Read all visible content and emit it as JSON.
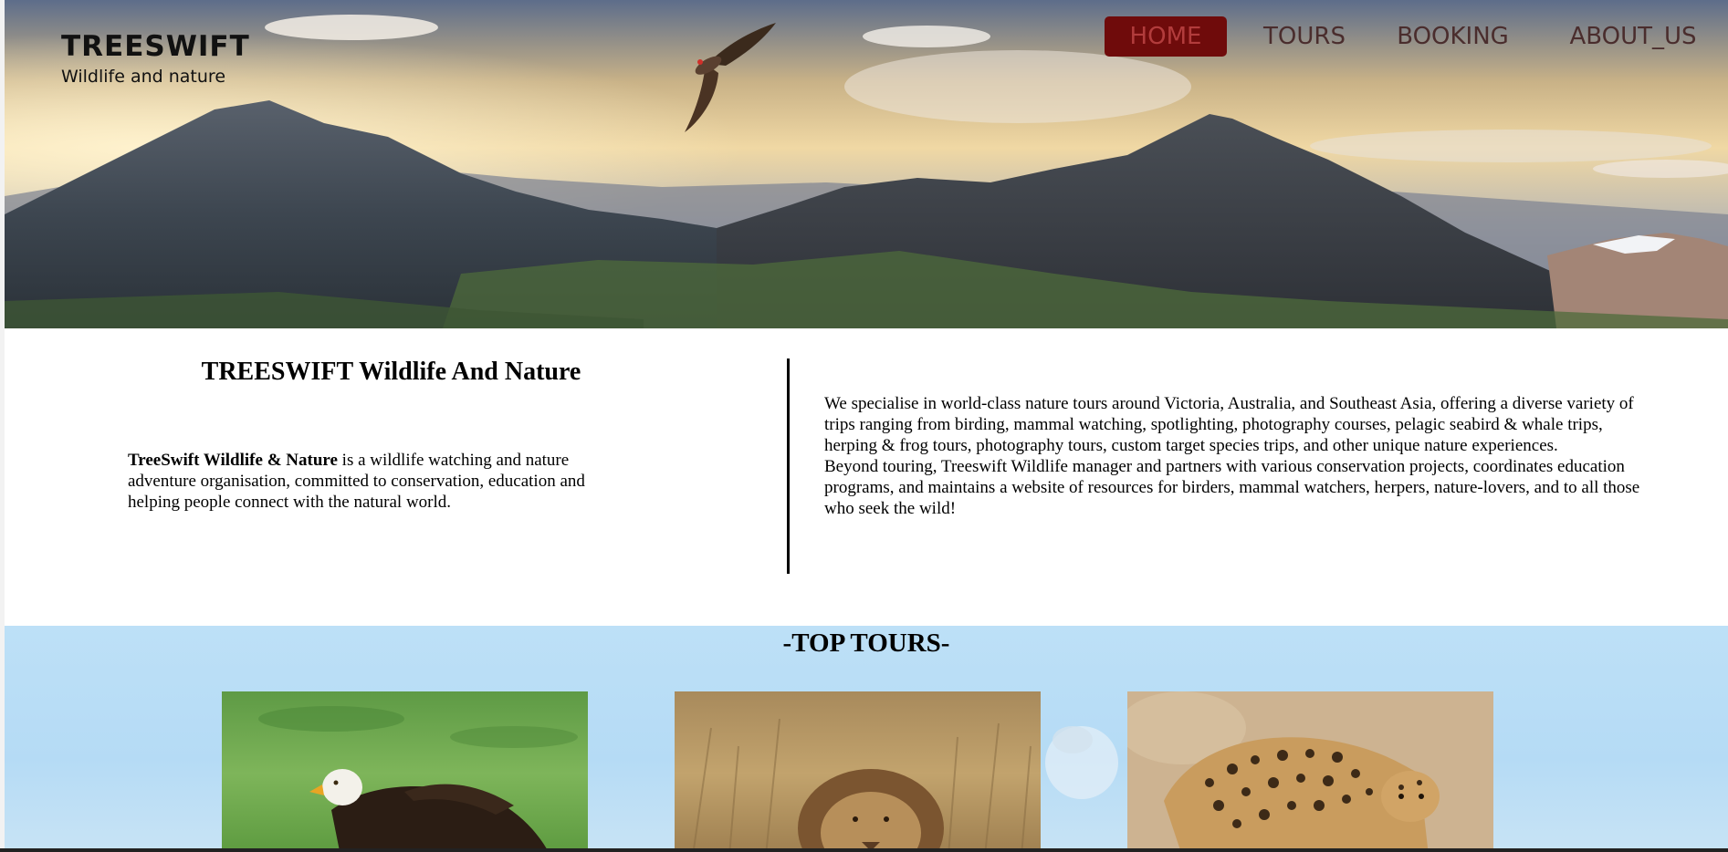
{
  "brand": {
    "title": "TREESWIFT",
    "subtitle": "Wildlife and nature"
  },
  "nav": {
    "items": [
      {
        "label": "HOME",
        "active": true
      },
      {
        "label": "TOURS",
        "active": false
      },
      {
        "label": "BOOKING",
        "active": false
      },
      {
        "label": "ABOUT_US",
        "active": false
      }
    ]
  },
  "intro": {
    "heading": "TREESWIFT Wildlife And Nature",
    "left_bold": "TreeSwift Wildlife & Nature",
    "left_text": " is a wildlife watching and nature adventure organisation, committed to conservation, education and helping people connect with the natural world.",
    "right_p1": "We specialise in world-class nature tours around Victoria, Australia, and Southeast Asia, offering a diverse variety of trips ranging from birding, mammal watching, spotlighting, photography courses, pelagic seabird & whale trips, herping & frog tours, photography tours, custom target species trips, and other unique nature experiences.",
    "right_p2": "Beyond touring, Treeswift Wildlife manager and partners with various conservation projects, coordinates education programs, and maintains a website of resources for birders, mammal watchers, herpers, nature-lovers, and to all those who seek the wild!"
  },
  "tours": {
    "title": "-TOP TOURS-",
    "cards": [
      {
        "image": "bald-eagle-photo"
      },
      {
        "image": "lion-photo"
      },
      {
        "image": "leopard-photo"
      }
    ]
  },
  "colors": {
    "nav_active_bg": "#6f0b0b",
    "nav_active_text": "#b23c3c",
    "nav_text": "#4a2d2d",
    "tours_bg": "#bde0f7"
  }
}
